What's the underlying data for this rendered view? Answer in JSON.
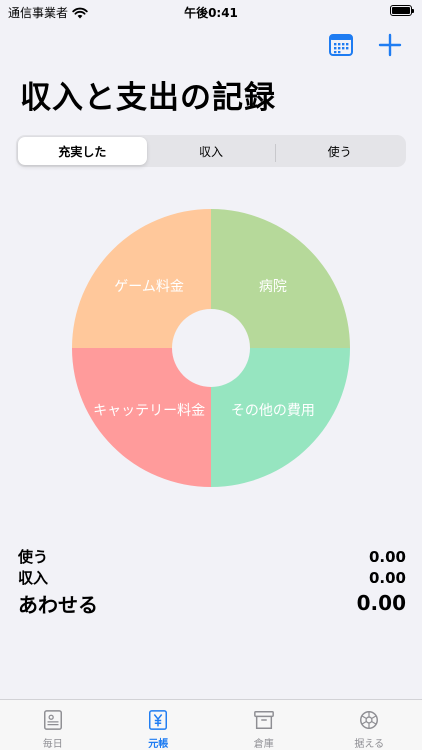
{
  "status_bar": {
    "carrier": "通信事業者",
    "time": "午後0:41"
  },
  "toolbar": {
    "calendar_icon": "calendar-icon",
    "add_icon": "plus-icon",
    "accent_color": "#1E7CF2"
  },
  "page": {
    "title": "収入と支出の記録"
  },
  "segments": [
    {
      "label": "充実した",
      "selected": true
    },
    {
      "label": "収入",
      "selected": false
    },
    {
      "label": "使う",
      "selected": false
    }
  ],
  "chart_data": {
    "type": "pie",
    "donut": true,
    "categories": [
      "病院",
      "その他の費用",
      "キャッテリー料金",
      "ゲーム料金"
    ],
    "values": [
      25,
      25,
      25,
      25
    ],
    "colors": [
      "#B6D99A",
      "#96E5C0",
      "#FF9B9B",
      "#FFC89B"
    ],
    "legend": "none"
  },
  "totals": {
    "spend_label": "使う",
    "spend_value": "0.00",
    "income_label": "収入",
    "income_value": "0.00",
    "sum_label": "あわせる",
    "sum_value": "0.00"
  },
  "tab_bar": {
    "tabs": [
      {
        "label": "毎日",
        "icon": "daily-note-icon",
        "active": false
      },
      {
        "label": "元帳",
        "icon": "yen-ledger-icon",
        "active": true
      },
      {
        "label": "倉庫",
        "icon": "archive-box-icon",
        "active": false
      },
      {
        "label": "据える",
        "icon": "settings-gear-icon",
        "active": false
      }
    ]
  }
}
